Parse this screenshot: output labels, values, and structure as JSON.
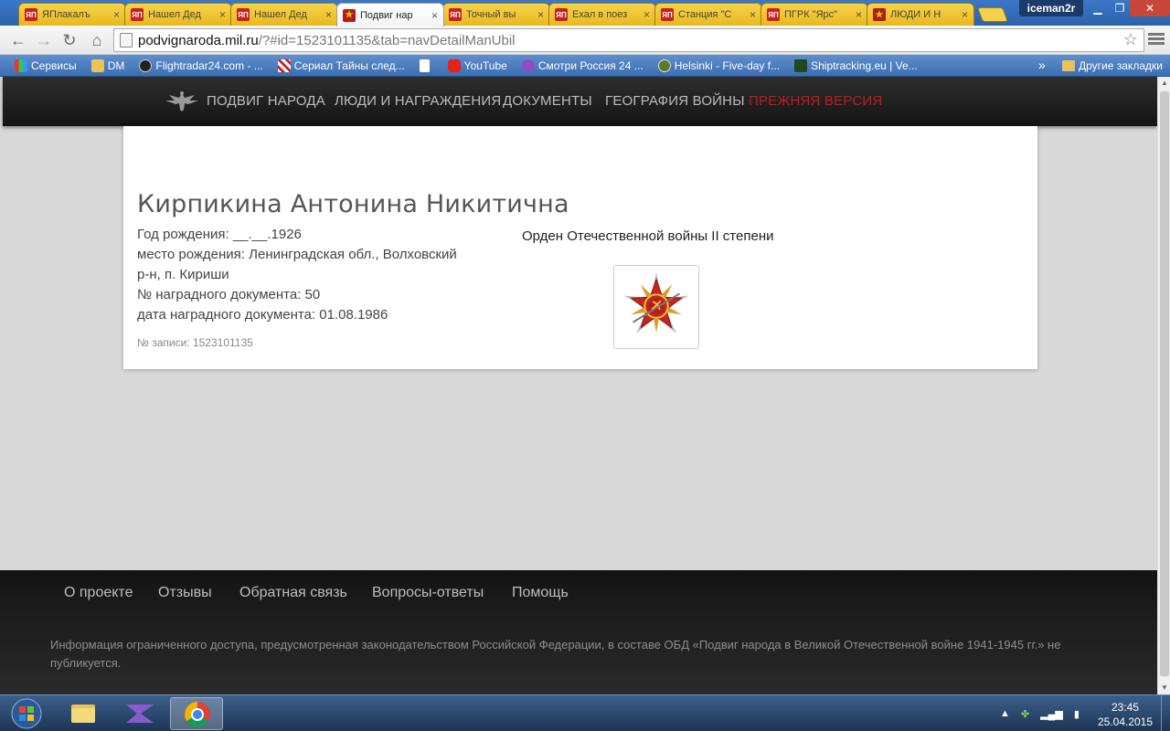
{
  "browser": {
    "tabs": [
      {
        "title": "ЯПлакалъ",
        "favicon": "yp",
        "active": false
      },
      {
        "title": "Нашел Дед",
        "favicon": "yp",
        "active": false
      },
      {
        "title": "Нашел Дед",
        "favicon": "yp",
        "active": false
      },
      {
        "title": "Подвиг нар",
        "favicon": "star",
        "active": true
      },
      {
        "title": "Точный вы",
        "favicon": "yp",
        "active": false
      },
      {
        "title": "Ехал в поез",
        "favicon": "yp",
        "active": false
      },
      {
        "title": "Станция \"С",
        "favicon": "yp",
        "active": false
      },
      {
        "title": "ПГРК \"Ярс\"",
        "favicon": "yp",
        "active": false
      },
      {
        "title": "ЛЮДИ И Н",
        "favicon": "star",
        "active": false
      }
    ],
    "favicon_text": "ЯП",
    "user": "iceman2r",
    "url_host": "podvignaroda.mil.ru",
    "url_rest": "/?#id=1523101135&tab=navDetailManUbil",
    "bookmarks": [
      {
        "label": "Сервисы",
        "icon": "apps-icon"
      },
      {
        "label": "DM",
        "icon": "folder-icon"
      },
      {
        "label": "Flightradar24.com - ...",
        "icon": "radar-icon"
      },
      {
        "label": "Сериал Тайны след...",
        "icon": "tv-icon"
      },
      {
        "label": "",
        "icon": "page-icon"
      },
      {
        "label": "YouTube",
        "icon": "youtube-icon"
      },
      {
        "label": "Смотри Россия 24 ...",
        "icon": "russia24-icon"
      },
      {
        "label": "Helsinki - Five-day f...",
        "icon": "weather-icon"
      },
      {
        "label": "Shiptracking.eu | Ve...",
        "icon": "ship-icon"
      }
    ],
    "bookmarks_more": "»",
    "other_bookmarks": "Другие закладки"
  },
  "site": {
    "nav": [
      {
        "label": "ПОДВИГ НАРОДА",
        "highlight": false
      },
      {
        "label": "ЛЮДИ И НАГРАЖДЕНИЯ",
        "highlight": false
      },
      {
        "label": "ДОКУМЕНТЫ",
        "highlight": false
      },
      {
        "label": "ГЕОГРАФИЯ ВОЙНЫ",
        "highlight": false
      },
      {
        "label": "ПРЕЖНЯЯ ВЕРСИЯ",
        "highlight": true
      }
    ],
    "accent_color": "#c41a1a"
  },
  "person": {
    "name": "Кирпикина Антонина Никитична",
    "birth_year": "Год рождения: __.__.1926",
    "birthplace_1": "место рождения: Ленинградская обл., Волховский",
    "birthplace_2": "р-н, п. Кириши",
    "doc_number": "№ наградного документа: 50",
    "doc_date": "дата наградного документа: 01.08.1986",
    "record_id": "№ записи: 1523101135"
  },
  "award": {
    "title": "Орден Отечественной войны II степени",
    "medal_icon": "order-patriotic-war-icon"
  },
  "footer": {
    "links": [
      "О проекте",
      "Отзывы",
      "Обратная связь",
      "Вопросы-ответы",
      "Помощь"
    ],
    "note": "Информация ограниченного доступа, предусмотренная законодательством Российской Федерации, в составе ОБД «Подвиг народа в Великой Отечественной войне 1941-1945 гг.» не публикуется."
  },
  "taskbar": {
    "time": "23:45",
    "date": "25.04.2015"
  }
}
